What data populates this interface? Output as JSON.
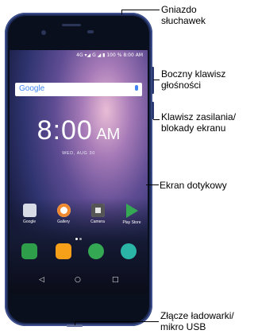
{
  "status_bar": "4G ▾◢ G ◢ ▮ 100 % 8:00 AM",
  "search": {
    "logo": "Google",
    "mic_icon": "mic-icon"
  },
  "clock": {
    "time": "8:00",
    "ampm": "AM",
    "date": "WED, AUG 30"
  },
  "apps": [
    {
      "label": "Google",
      "icon": "google-folder-icon"
    },
    {
      "label": "Gallery",
      "icon": "gallery-icon"
    },
    {
      "label": "Camera",
      "icon": "camera-icon"
    },
    {
      "label": "Play Store",
      "icon": "play-store-icon"
    }
  ],
  "dock": [
    {
      "icon": "phone-icon",
      "color": "#2e9e4a"
    },
    {
      "icon": "contacts-icon",
      "color": "#f6a01a"
    },
    {
      "icon": "messages-icon",
      "color": "#34a853"
    },
    {
      "icon": "browser-icon",
      "color": "#2bb5a6"
    }
  ],
  "nav": {
    "back": "◁",
    "home": "○",
    "recents": "□"
  },
  "callouts": {
    "headphone_jack": [
      "Gniazdo",
      "słuchawek"
    ],
    "volume_key": [
      "Boczny klawisz",
      "głośności"
    ],
    "power_key": [
      "Klawisz zasilania/",
      "blokady ekranu"
    ],
    "touchscreen": "Ekran dotykowy",
    "charger_port": [
      "Złącze ładowarki/",
      "mikro USB"
    ]
  },
  "colors": {
    "phone_body": "#1d2b56",
    "accent": "#4285f4"
  }
}
